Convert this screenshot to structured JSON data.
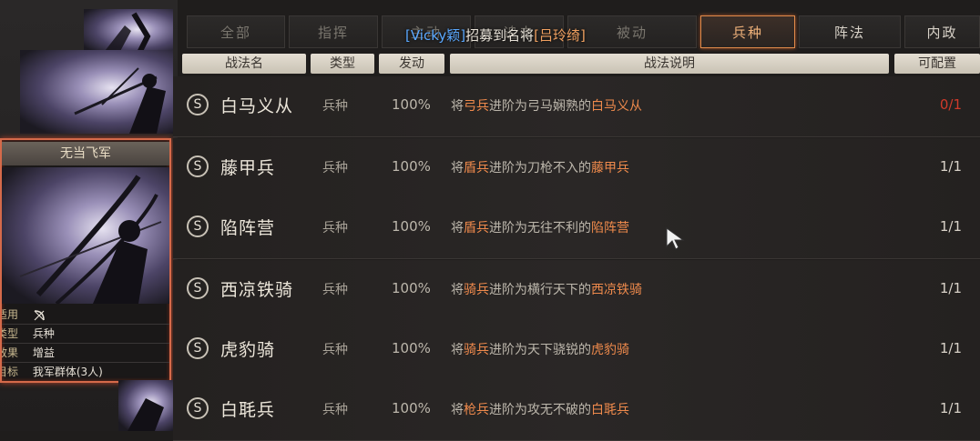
{
  "tabs": [
    {
      "label": "全部",
      "state": "dim"
    },
    {
      "label": "指挥",
      "state": "dim"
    },
    {
      "label": "主动",
      "state": "dim"
    },
    {
      "label": "追击",
      "state": "dim"
    },
    {
      "label": "被动",
      "state": "dim"
    },
    {
      "label": "兵种",
      "state": "active"
    },
    {
      "label": "阵法",
      "state": "bright"
    },
    {
      "label": "内政",
      "state": "bright"
    }
  ],
  "toast": {
    "player": "[Vicky颖]",
    "action": "招募到名将",
    "general": "[吕玲绮]"
  },
  "headers": {
    "name": "战法名",
    "type": "类型",
    "trigger": "发动",
    "desc": "战法说明",
    "config": "可配置"
  },
  "card": {
    "title": "无当飞军",
    "rows": [
      {
        "key": "适用",
        "value": "",
        "icon": "bow-icon"
      },
      {
        "key": "类型",
        "value": "兵种"
      },
      {
        "key": "效果",
        "value": "增益"
      },
      {
        "key": "目标",
        "value": "我军群体(3人)"
      }
    ]
  },
  "skills": [
    {
      "grade": "S",
      "name": "白马义从",
      "type": "兵种",
      "rate": "100%",
      "d1": "将",
      "d2": "弓兵",
      "d3": "进阶为弓马娴熟的",
      "d4": "白马义从",
      "count": "0/1",
      "count_color": "#d03a2a"
    },
    {
      "grade": "S",
      "name": "藤甲兵",
      "type": "兵种",
      "rate": "100%",
      "d1": "将",
      "d2": "盾兵",
      "d3": "进阶为刀枪不入的",
      "d4": "藤甲兵",
      "count": "1/1"
    },
    {
      "grade": "S",
      "name": "陷阵营",
      "type": "兵种",
      "rate": "100%",
      "d1": "将",
      "d2": "盾兵",
      "d3": "进阶为无往不利的",
      "d4": "陷阵营",
      "count": "1/1"
    },
    {
      "grade": "S",
      "name": "西凉铁骑",
      "type": "兵种",
      "rate": "100%",
      "d1": "将",
      "d2": "骑兵",
      "d3": "进阶为横行天下的",
      "d4": "西凉铁骑",
      "count": "1/1"
    },
    {
      "grade": "S",
      "name": "虎豹骑",
      "type": "兵种",
      "rate": "100%",
      "d1": "将",
      "d2": "骑兵",
      "d3": "进阶为天下骁锐的",
      "d4": "虎豹骑",
      "count": "1/1"
    },
    {
      "grade": "S",
      "name": "白毦兵",
      "type": "兵种",
      "rate": "100%",
      "d1": "将",
      "d2": "枪兵",
      "d3": "进阶为攻无不破的",
      "d4": "白毦兵",
      "count": "1/1"
    }
  ]
}
